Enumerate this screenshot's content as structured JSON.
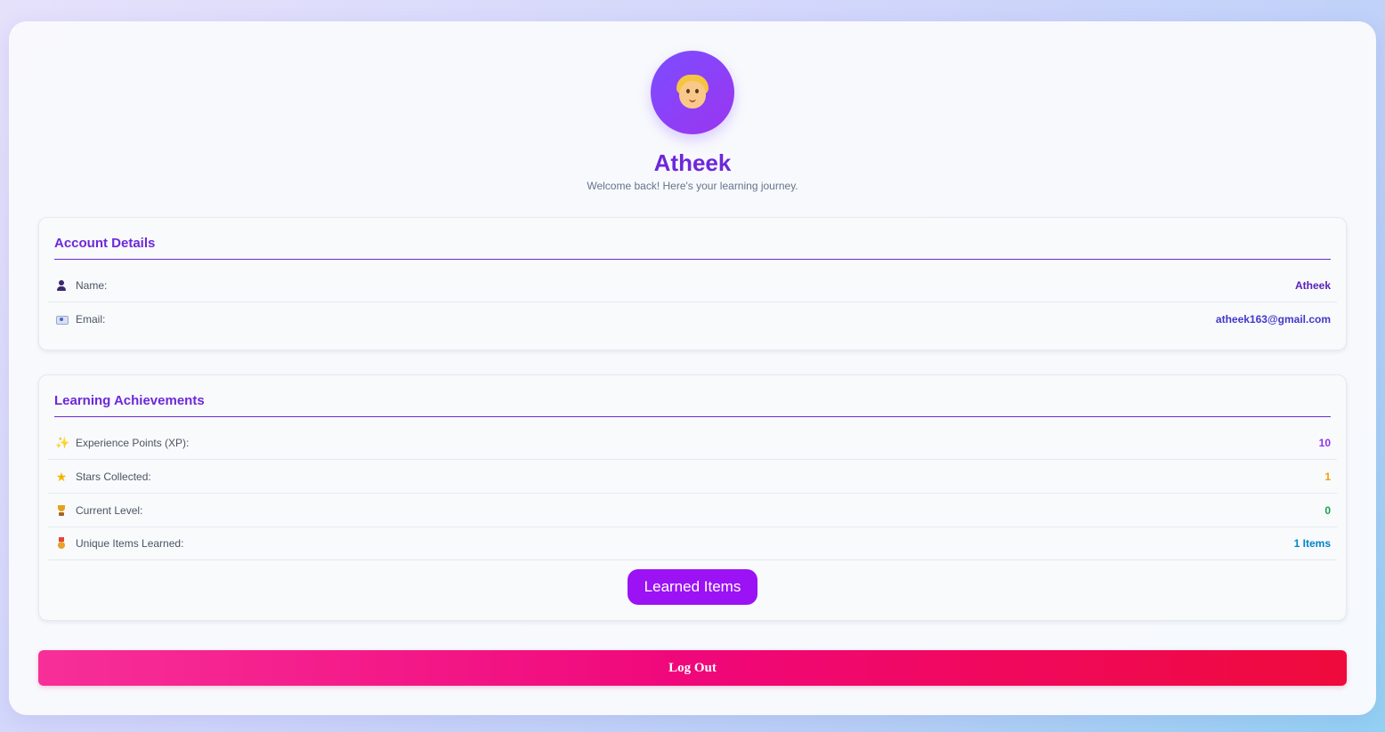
{
  "profile": {
    "avatar_icon": "blond-person-emoji-icon",
    "name": "Atheek",
    "subtitle": "Welcome back! Here's your learning journey."
  },
  "account": {
    "title": "Account Details",
    "rows": [
      {
        "icon": "person-icon",
        "label": "Name:",
        "value": "Atheek",
        "color": "#5b21b6"
      },
      {
        "icon": "email-icon",
        "label": "Email:",
        "value": "atheek163@gmail.com",
        "color": "#4338ca"
      }
    ]
  },
  "achievements": {
    "title": "Learning Achievements",
    "rows": [
      {
        "icon": "sparkles-icon",
        "label": "Experience Points (XP):",
        "value": "10",
        "color": "#9333ea"
      },
      {
        "icon": "star-icon",
        "label": "Stars Collected:",
        "value": "1",
        "color": "#f59e0b"
      },
      {
        "icon": "trophy-icon",
        "label": "Current Level:",
        "value": "0",
        "color": "#16a34a"
      },
      {
        "icon": "medal-icon",
        "label": "Unique Items Learned:",
        "value": "1 Items",
        "color": "#0284c7"
      }
    ],
    "button_label": "Learned Items"
  },
  "logout_label": "Log Out",
  "colors": {
    "accent": "#6d28d9",
    "button_purple": "#9b12f5",
    "logout_start": "#f72f98",
    "logout_end": "#ef0a3c"
  }
}
